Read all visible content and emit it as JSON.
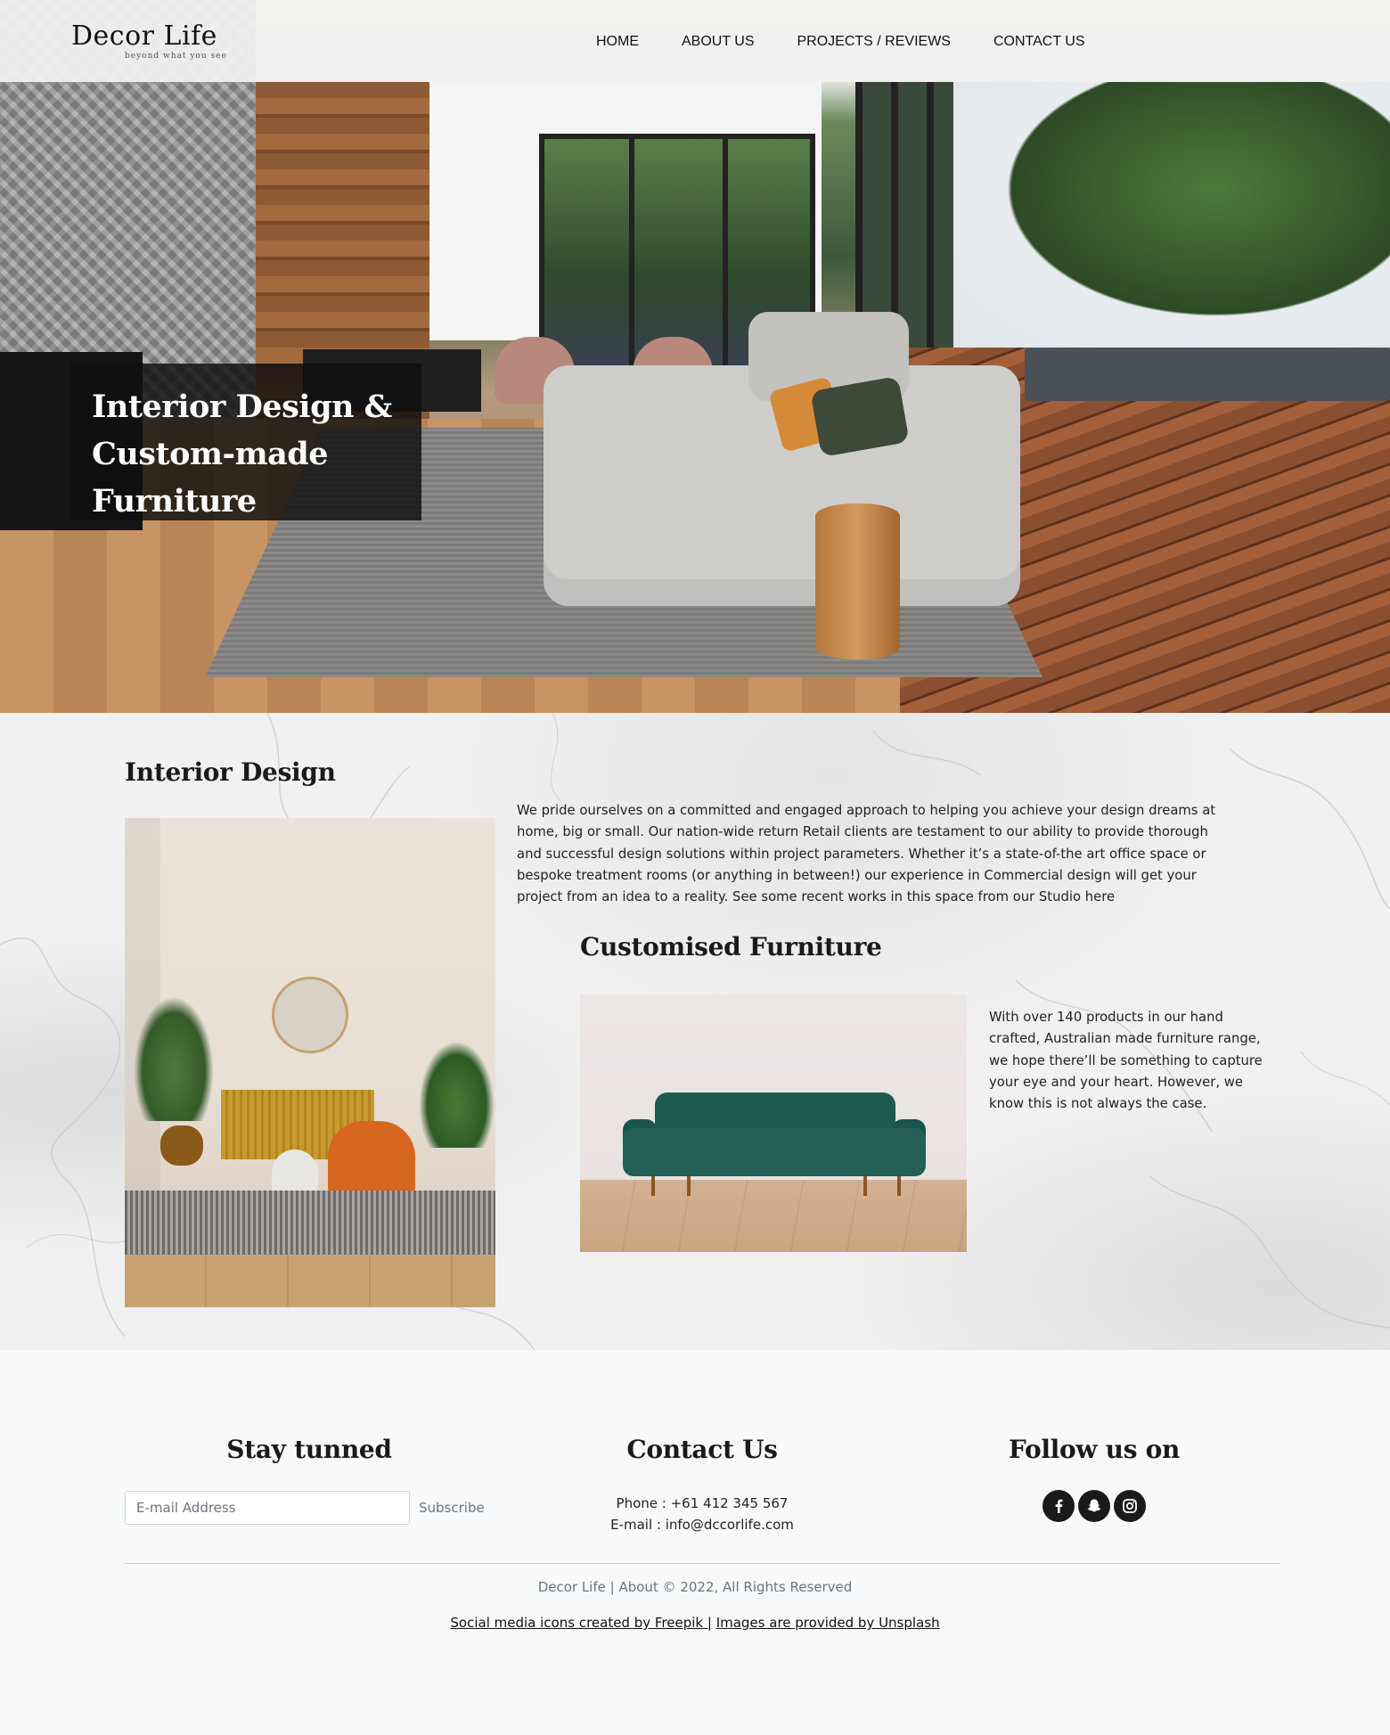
{
  "brand": {
    "name": "Decor Life",
    "tagline": "beyond what you see"
  },
  "nav": {
    "items": [
      {
        "label": "HOME"
      },
      {
        "label": "ABOUT US"
      },
      {
        "label": "PROJECTS / REVIEWS"
      },
      {
        "label": "CONTACT US"
      }
    ]
  },
  "hero": {
    "title_line1": "Interior Design &",
    "title_line2": "Custom-made",
    "title_line3": "Furniture"
  },
  "interior": {
    "heading": "Interior Design",
    "body": "We pride ourselves on a committed and engaged approach to helping you achieve your design dreams at home, big or small. Our nation-wide return Retail clients are testament to our ability to provide thorough and successful design solutions within project parameters. Whether it’s a state-of-the art office space or bespoke treatment rooms (or anything in between!) our experience in Commercial design will get your project from an idea to a reality. See some recent works in this space from our Studio here"
  },
  "furniture": {
    "heading": "Customised Furniture",
    "body": "With over 140 products in our hand crafted, Australian made furniture range, we hope there’ll be something to capture your eye and your heart. However, we know this is not always the case."
  },
  "footer": {
    "stay_title": "Stay tunned",
    "email_placeholder": "E-mail Address",
    "subscribe_label": "Subscribe",
    "contact_title": "Contact Us",
    "phone": "Phone : +61 412 345 567",
    "email": "E-mail : info@dccorlife.com",
    "follow_title": "Follow us on",
    "social": [
      "facebook-icon",
      "snapchat-icon",
      "instagram-icon"
    ],
    "copyright": "Decor Life | About © 2022, All Rights Reserved",
    "credit_freepik": "Social media icons created by Freepik |",
    "credit_unsplash": "Images are provided by Unsplash"
  },
  "colors": {
    "caption_bg": "#0f0f0f",
    "social_bg": "#1a1a1a",
    "muted": "#6c757d"
  }
}
